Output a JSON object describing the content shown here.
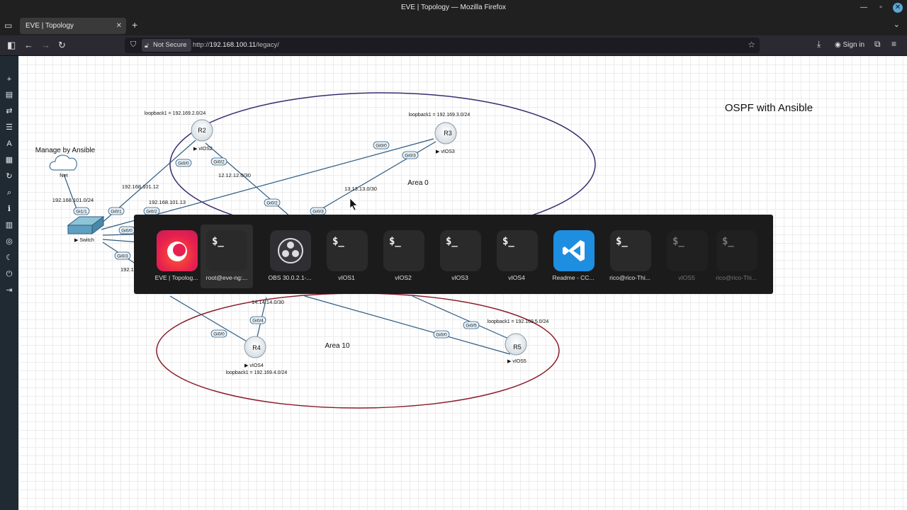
{
  "window": {
    "title": "EVE | Topology — Mozilla Firefox"
  },
  "browser": {
    "tab_title": "EVE | Topology",
    "not_secure_label": "Not Secure",
    "url_prefix": "http://",
    "url_host": "192.168.100.11",
    "url_path": "/legacy/",
    "sign_in_label": "Sign in"
  },
  "topology": {
    "title": "OSPF with Ansible",
    "areas": [
      {
        "label": "Area 0"
      },
      {
        "label": "Area 10"
      }
    ],
    "cloud": {
      "caption": "Manage by Ansible",
      "label": "Net",
      "network": "192.168.101.0/24"
    },
    "switch": {
      "label": "Switch"
    },
    "routers": [
      {
        "name": "R2",
        "node": "vIOS2",
        "loopback": "loopback1 = 192.169.2.0/24"
      },
      {
        "name": "R3",
        "node": "vIOS3",
        "loopback": "loopback1 = 192.169.3.0/24"
      },
      {
        "name": "R4",
        "node": "vIOS4",
        "loopback": "loopback1 = 192.169.4.0/24"
      },
      {
        "name": "R5",
        "node": "vIOS5",
        "loopback": "loopback1 = 192.169.5.0/24"
      }
    ],
    "networks": [
      "12.12.12.0/30",
      "13.13.13.0/30",
      "14.14.14.0/30"
    ],
    "ip_labels": [
      "192.168.101.12",
      "192.168.101.13",
      "192.1"
    ],
    "interfaces": [
      "Gi0/0",
      "Gi0/2",
      "Gi0/0",
      "Gi0/3",
      "Gi0/2",
      "Gi0/3",
      "Gi1/1",
      "Gi0/1",
      "Gi0/2",
      "Gi0/0",
      "Gi0/3",
      "Gi0/4",
      "Gi0/0",
      "Gi0/5",
      "Gi0/0"
    ]
  },
  "switcher": {
    "apps": [
      {
        "label": "EVE | Topolog...",
        "icon": "firefox-icon",
        "glyph": ""
      },
      {
        "label": "root@eve-ng:...",
        "icon": "terminal-icon",
        "glyph": "$_"
      },
      {
        "label": "OBS 30.0.2.1-...",
        "icon": "obs-icon",
        "glyph": ""
      },
      {
        "label": "vIOS1",
        "icon": "terminal-icon",
        "glyph": "$_"
      },
      {
        "label": "vIOS2",
        "icon": "terminal-icon",
        "glyph": "$_"
      },
      {
        "label": "vIOS3",
        "icon": "terminal-icon",
        "glyph": "$_"
      },
      {
        "label": "vIOS4",
        "icon": "terminal-icon",
        "glyph": "$_"
      },
      {
        "label": "Readme - CC...",
        "icon": "vscode-icon",
        "glyph": ""
      },
      {
        "label": "rico@rico-Thi...",
        "icon": "terminal-icon",
        "glyph": "$_"
      },
      {
        "label": "vIOS5",
        "icon": "terminal-icon",
        "glyph": "$_"
      },
      {
        "label": "rico@rico-Thi...",
        "icon": "terminal-icon",
        "glyph": "$_"
      }
    ]
  }
}
